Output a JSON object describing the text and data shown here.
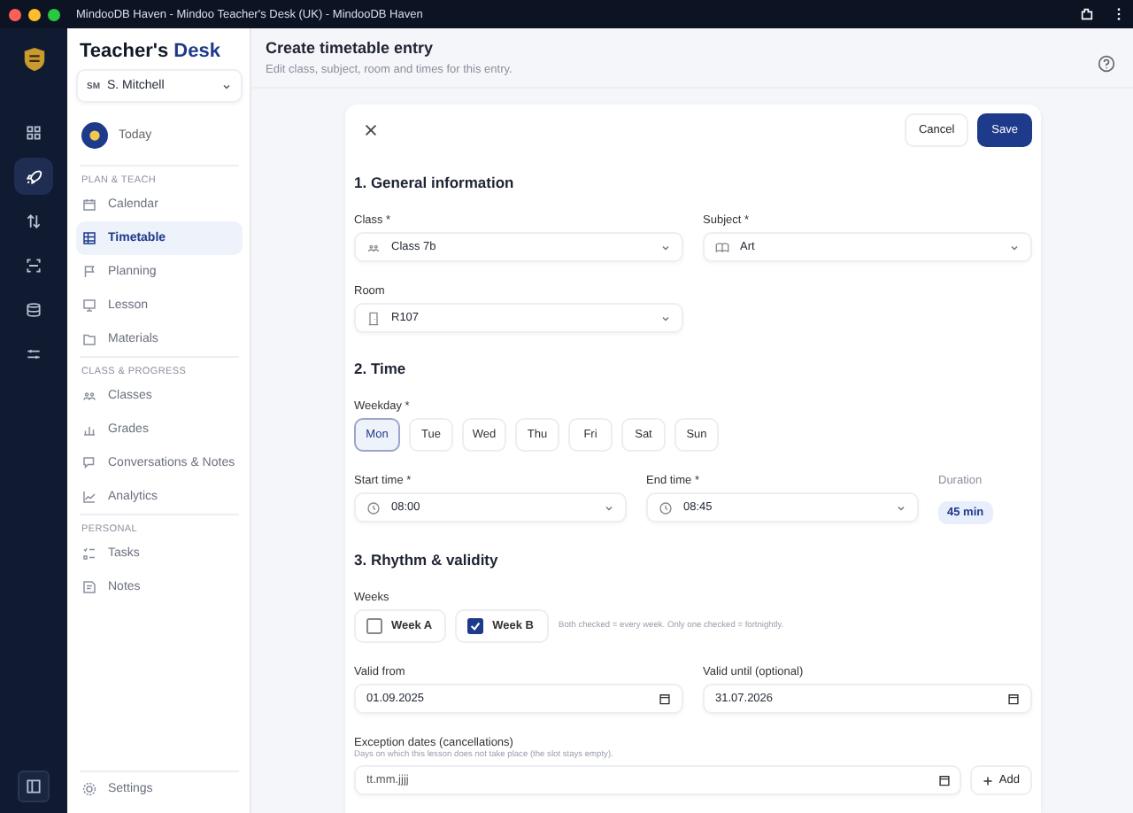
{
  "window": {
    "title": "MindooDB Haven - Mindoo Teacher's Desk (UK) - MindooDB Haven"
  },
  "rail": {
    "items": [
      {
        "kind": "grid",
        "selected": false
      },
      {
        "kind": "rocket",
        "selected": true
      },
      {
        "kind": "swap",
        "selected": false
      },
      {
        "kind": "scan",
        "selected": false
      },
      {
        "kind": "database",
        "selected": false
      },
      {
        "kind": "sliders",
        "selected": false
      }
    ]
  },
  "sidebar": {
    "brand": "Teacher's",
    "brand_accent": "Desk",
    "user": {
      "initials": "SM",
      "name": "S. Mitchell"
    },
    "today": "Today",
    "sections": [
      {
        "heading": "PLAN & TEACH",
        "items": [
          {
            "label": "Calendar",
            "kind": "calendar",
            "selected": false
          },
          {
            "label": "Timetable",
            "kind": "table",
            "selected": true
          },
          {
            "label": "Planning",
            "kind": "flag",
            "selected": false
          },
          {
            "label": "Lesson",
            "kind": "screen",
            "selected": false
          },
          {
            "label": "Materials",
            "kind": "folder",
            "selected": false
          }
        ]
      },
      {
        "heading": "CLASS & PROGRESS",
        "items": [
          {
            "label": "Classes",
            "kind": "people",
            "selected": false
          },
          {
            "label": "Grades",
            "kind": "bars",
            "selected": false
          },
          {
            "label": "Conversations & Notes",
            "kind": "chat",
            "selected": false
          },
          {
            "label": "Analytics",
            "kind": "linechart",
            "selected": false
          }
        ]
      },
      {
        "heading": "PERSONAL",
        "items": [
          {
            "label": "Tasks",
            "kind": "checklist",
            "selected": false
          },
          {
            "label": "Notes",
            "kind": "note",
            "selected": false
          }
        ]
      }
    ],
    "settings": "Settings"
  },
  "header": {
    "title": "Create timetable entry",
    "subtitle": "Edit class, subject, room and times for this entry."
  },
  "form": {
    "cancel": "Cancel",
    "save": "Save",
    "general": {
      "heading": "1. General information",
      "class": {
        "label": "Class *",
        "value": "Class 7b"
      },
      "subject": {
        "label": "Subject *",
        "value": "Art"
      },
      "room": {
        "label": "Room",
        "value": "R107"
      }
    },
    "time": {
      "heading": "2. Time",
      "weekday_label": "Weekday *",
      "weekdays": [
        {
          "label": "Mon",
          "selected": true
        },
        {
          "label": "Tue",
          "selected": false
        },
        {
          "label": "Wed",
          "selected": false
        },
        {
          "label": "Thu",
          "selected": false
        },
        {
          "label": "Fri",
          "selected": false
        },
        {
          "label": "Sat",
          "selected": false
        },
        {
          "label": "Sun",
          "selected": false
        }
      ],
      "start": {
        "label": "Start time *",
        "value": "08:00"
      },
      "end": {
        "label": "End time *",
        "value": "08:45"
      },
      "duration": {
        "label": "Duration",
        "value": "45 min"
      }
    },
    "rhythm": {
      "heading": "3. Rhythm & validity",
      "weeks_label": "Weeks",
      "weeks": [
        {
          "label": "Week A",
          "checked": false
        },
        {
          "label": "Week B",
          "checked": true
        }
      ],
      "weeks_hint": "Both checked = every week. Only one checked = fortnightly.",
      "valid_from": {
        "label": "Valid from",
        "value": "01.09.2025"
      },
      "valid_until": {
        "label": "Valid until (optional)",
        "value": "31.07.2026"
      },
      "exceptions": {
        "label": "Exception dates (cancellations)",
        "hint": "Days on which this lesson does not take place (the slot stays empty).",
        "placeholder": "tt.mm.jjjj",
        "add": "Add"
      }
    }
  }
}
